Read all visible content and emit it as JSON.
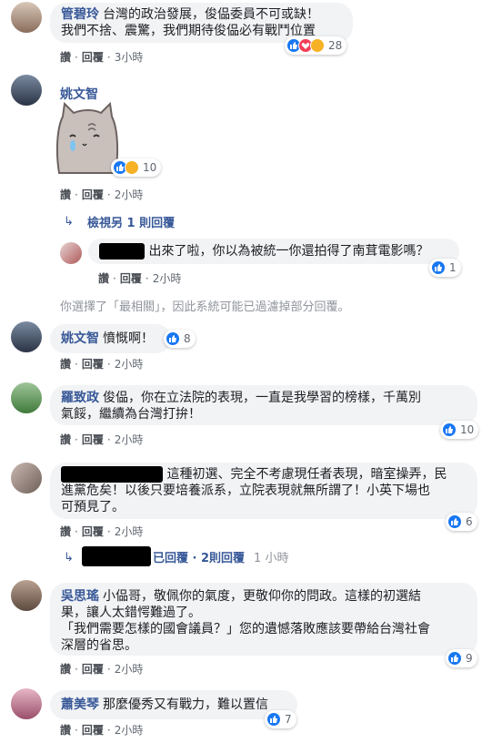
{
  "actions": {
    "like": "讚",
    "reply": "回覆",
    "dot": "·"
  },
  "c1": {
    "name": "管碧玲",
    "text": "台灣的政治發展，俊偘委員不可或缺！\n我們不捨、震驚，我們期待俊偘必有戰鬥位置",
    "time": "3小時",
    "reactions": "28"
  },
  "c2": {
    "name": "姚文智",
    "time": "2小時",
    "reactions": "10",
    "sticker": "sad-cat-sticker",
    "more_replies": "檢視另 1 則回覆"
  },
  "c2r": {
    "text": "出來了啦，你以為被統一你還拍得了南茸電影嗎？",
    "time": "2小時",
    "reactions": "1"
  },
  "filter_note": "你選擇了「最相關」，因此系統可能已過濾掉部分回覆。",
  "c3": {
    "name": "姚文智",
    "text": "憤慨啊！",
    "time": "2小時",
    "reactions": "8"
  },
  "c4": {
    "name": "羅致政",
    "text": "俊偘，你在立法院的表現，一直是我學習的榜樣，千萬別\n氣餒，繼續為台灣打拚！",
    "time": "2小時",
    "reactions": "10"
  },
  "c5": {
    "text": "這種初選、完全不考慮現任者表現，暗室操弄，民\n進黨危矣！以後只要培養派系，立院表現就無所謂了！小英下場也\n可預見了。",
    "time": "2小時",
    "reactions": "6",
    "reply_summary": "已回覆 · 2則回覆",
    "reply_time": "1 小時"
  },
  "c6": {
    "name": "吳思瑤",
    "text": "小偘哥，敬佩你的氣度，更敬仰你的問政。這樣的初選結\n果，讓人太錯愕難過了。\n「我們需要怎樣的國會議員？」您的遺憾落敗應該要帶給台灣社會\n深層的省思。",
    "time": "2小時",
    "reactions": "9"
  },
  "c7": {
    "name": "蕭美琴",
    "text": "那麼優秀又有戰力，難以置信",
    "time": "2小時",
    "reactions": "7"
  },
  "colors": {
    "link": "#385898",
    "bubble": "#f2f3f5",
    "like": "#1877f2"
  }
}
